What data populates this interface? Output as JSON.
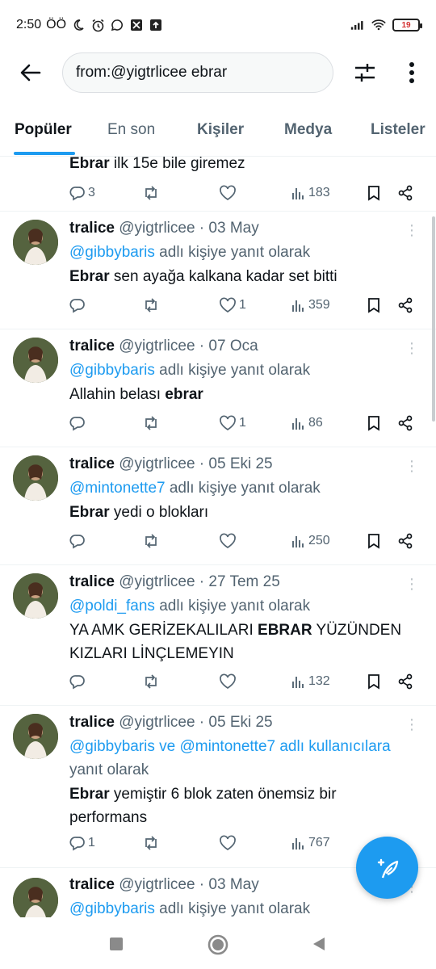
{
  "status_bar": {
    "time": "2:50",
    "carrier_label": "ÖÖ",
    "battery": "19"
  },
  "search": {
    "query": "from:@yigtrlicee ebrar"
  },
  "tabs": [
    {
      "label": "Popüler"
    },
    {
      "label": "En son"
    },
    {
      "label": "Kişiler"
    },
    {
      "label": "Medya"
    },
    {
      "label": "Listeler"
    }
  ],
  "tweets": [
    {
      "text_bold": "Ebrar",
      "text_rest": " ilk 15e bile giremez",
      "replies": "3",
      "likes": "",
      "views": "183"
    },
    {
      "name": "tralice",
      "handle_date": "@yigtrlicee · 03 May",
      "reply_link": "@gibbybaris",
      "reply_suffix": " adlı kişiye yanıt olarak",
      "text_bold": "Ebrar",
      "text_rest": " sen ayağa kalkana kadar set bitti",
      "replies": "",
      "likes": "1",
      "views": "359"
    },
    {
      "name": "tralice",
      "handle_date": "@yigtrlicee · 07 Oca",
      "reply_link": "@gibbybaris",
      "reply_suffix": " adlı kişiye yanıt olarak",
      "text_pre": "Allahin belası ",
      "text_bold": "ebrar",
      "replies": "",
      "likes": "1",
      "views": "86"
    },
    {
      "name": "tralice",
      "handle_date": "@yigtrlicee · 05 Eki 25",
      "reply_link": "@mintonette7",
      "reply_suffix": " adlı kişiye yanıt olarak",
      "text_bold": "Ebrar",
      "text_rest": " yedi o blokları",
      "replies": "",
      "likes": "",
      "views": "250"
    },
    {
      "name": "tralice",
      "handle_date": "@yigtrlicee · 27 Tem 25",
      "reply_link": "@poldi_fans",
      "reply_suffix": " adlı kişiye yanıt olarak",
      "text_pre": "YA AMK GERİZEKALILARI ",
      "text_bold": "EBRAR",
      "text_rest": " YÜZÜNDEN",
      "text_line2": "KIZLARI LİNÇLEMEYIN",
      "replies": "",
      "likes": "",
      "views": "132"
    },
    {
      "name": "tralice",
      "handle_date": "@yigtrlicee · 05 Eki 25",
      "reply_link": "@gibbybaris ve @mintonette7 adlı kullanıcılara",
      "reply_suffix": "yanıt olarak",
      "text_bold": "Ebrar",
      "text_rest": " yemiştir 6 blok zaten önemsiz bir",
      "text_line2": "performans",
      "replies": "1",
      "likes": "",
      "views": "767"
    },
    {
      "name": "tralice",
      "handle_date": "@yigtrlicee · 03 May",
      "reply_link": "@gibbybaris",
      "reply_suffix": " adlı kişiye yanıt olarak"
    }
  ],
  "colors": {
    "accent": "#1d9bf0",
    "text": "#0f1419",
    "secondary": "#536471"
  }
}
